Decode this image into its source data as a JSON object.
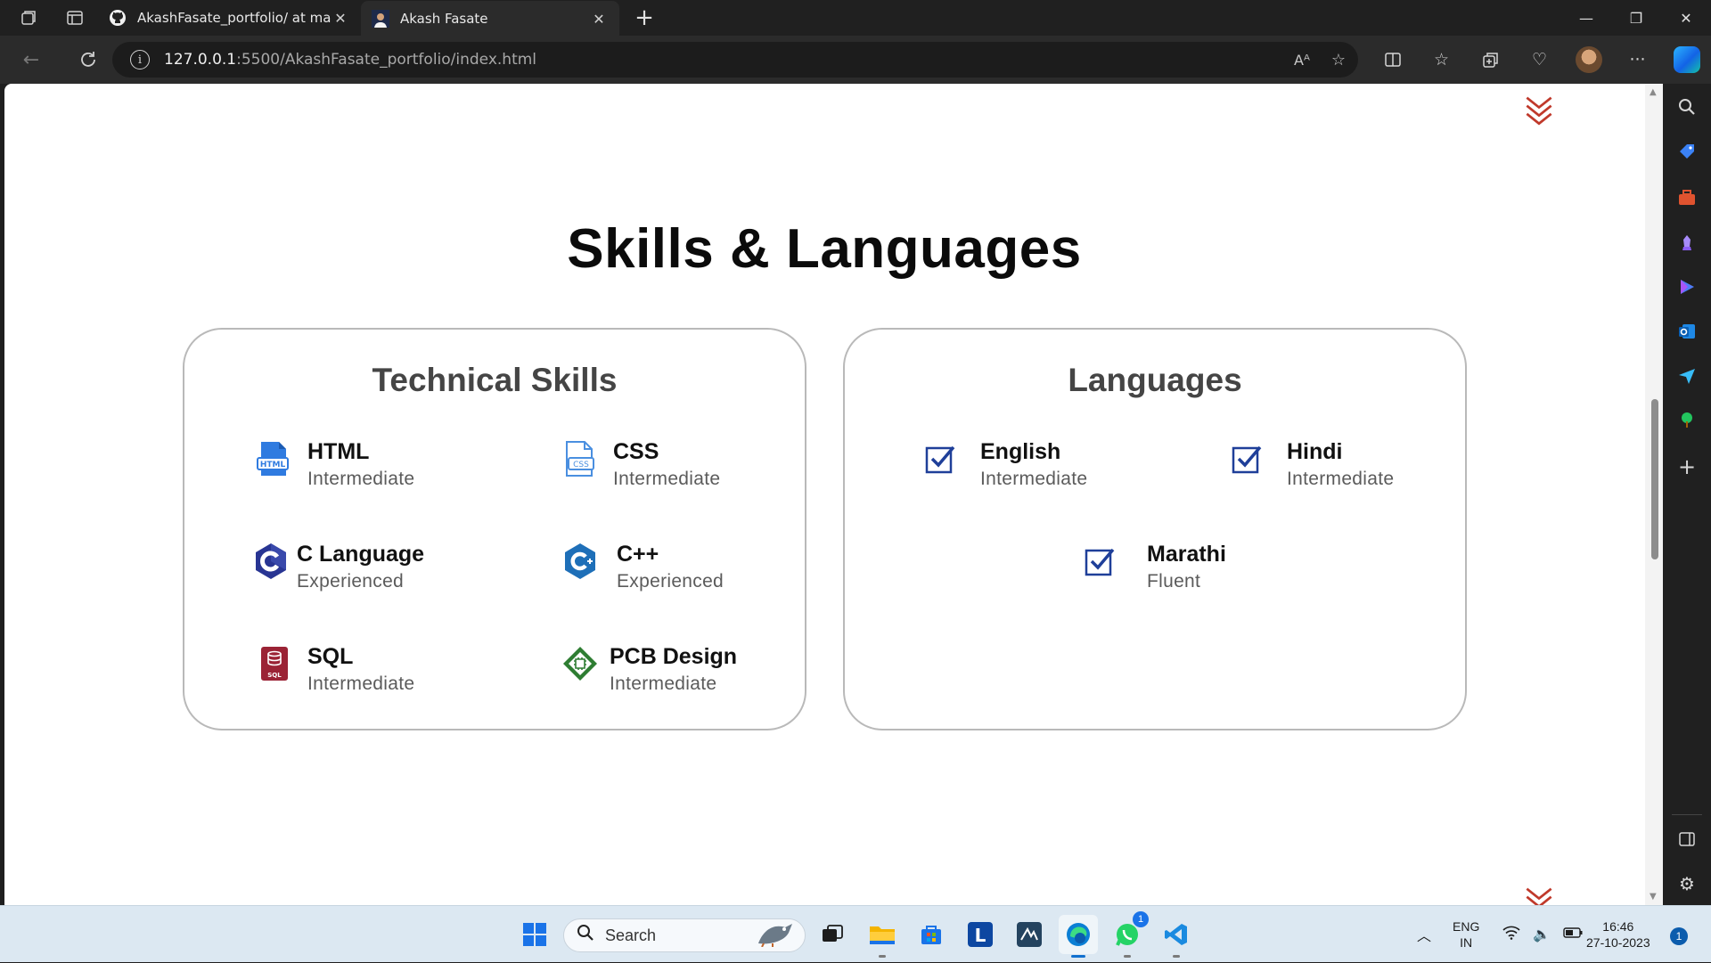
{
  "browser": {
    "tabs": [
      {
        "title": "AkashFasate_portfolio/ at main ·",
        "icon": "github-icon"
      },
      {
        "title": "Akash Fasate",
        "icon": "profile-photo-icon"
      }
    ],
    "url_host": "127.0.0.1",
    "url_path": ":5500/AkashFasate_portfolio/index.html"
  },
  "page": {
    "section_title": "Skills & Languages",
    "skills_card": {
      "title": "Technical Skills",
      "items": [
        {
          "name": "HTML",
          "level": "Intermediate",
          "icon": "html-file-icon"
        },
        {
          "name": "CSS",
          "level": "Intermediate",
          "icon": "css-file-icon"
        },
        {
          "name": "C Language",
          "level": "Experienced",
          "icon": "c-language-icon"
        },
        {
          "name": "C++",
          "level": "Experienced",
          "icon": "cpp-icon"
        },
        {
          "name": "SQL",
          "level": "Intermediate",
          "icon": "sql-database-icon"
        },
        {
          "name": "PCB Design",
          "level": "Intermediate",
          "icon": "pcb-circuit-icon"
        }
      ]
    },
    "languages_card": {
      "title": "Languages",
      "items": [
        {
          "name": "English",
          "level": "Intermediate",
          "icon": "checkbox-checked-icon"
        },
        {
          "name": "Hindi",
          "level": "Intermediate",
          "icon": "checkbox-checked-icon"
        },
        {
          "name": "Marathi",
          "level": "Fluent",
          "icon": "checkbox-checked-icon"
        }
      ]
    }
  },
  "taskbar": {
    "search_label": "Search",
    "lang_line1": "ENG",
    "lang_line2": "IN",
    "time": "16:46",
    "date": "27-10-2023",
    "notification_count": "1",
    "whatsapp_badge": "1"
  },
  "colors": {
    "accent_red": "#c0392b",
    "html_blue": "#2f7be0",
    "c_blue": "#283593",
    "check_blue": "#1f3f99",
    "sql_maroon": "#9b2335",
    "pcb_green": "#2e7d32"
  }
}
